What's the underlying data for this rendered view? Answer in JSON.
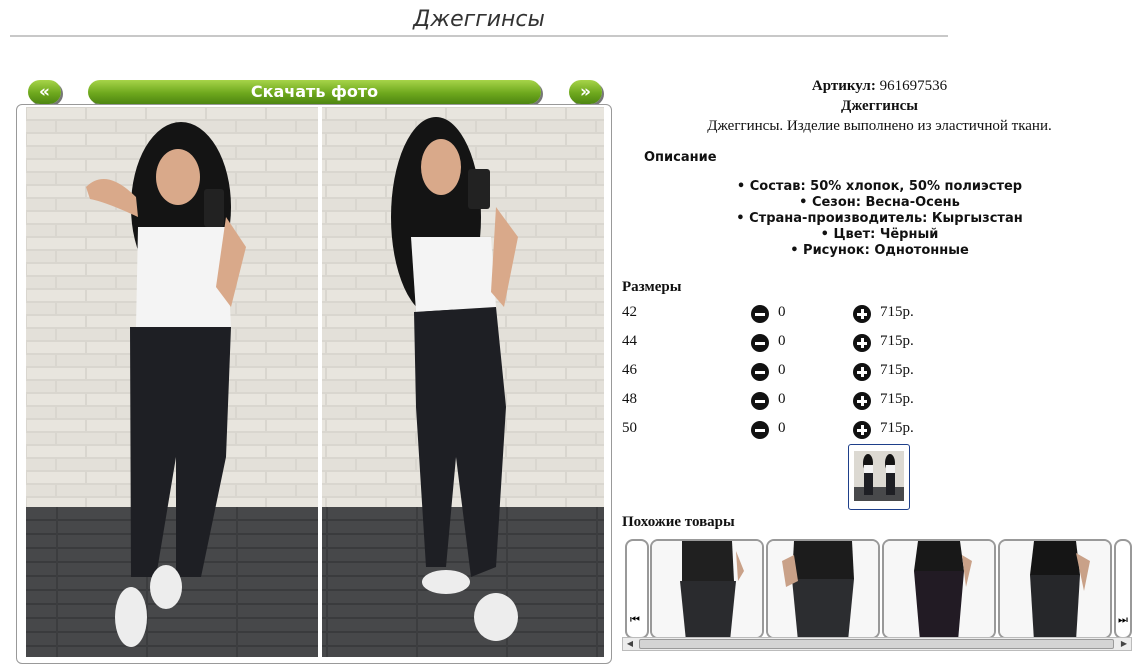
{
  "page": {
    "title": "Джеггинсы"
  },
  "gallery": {
    "prev_label": "«",
    "next_label": "»",
    "download_label": "Скачать фото"
  },
  "product": {
    "article_label": "Артикул:",
    "article_value": "961697536",
    "name": "Джеггинсы",
    "short_description": "Джеггинсы. Изделие выполнено из эластичной ткани.",
    "description_heading": "Описание",
    "properties": [
      "Состав: 50% хлопок, 50% полиэстер",
      "Сезон: Весна-Осень",
      "Страна-производитель: Кыргызстан",
      "Цвет: Чёрный",
      "Рисунок: Однотонные"
    ],
    "bullet": "•"
  },
  "sizes": {
    "heading": "Размеры",
    "rows": [
      {
        "size": "42",
        "qty": "0",
        "price": "715р."
      },
      {
        "size": "44",
        "qty": "0",
        "price": "715р."
      },
      {
        "size": "46",
        "qty": "0",
        "price": "715р."
      },
      {
        "size": "48",
        "qty": "0",
        "price": "715р."
      },
      {
        "size": "50",
        "qty": "0",
        "price": "715р."
      }
    ]
  },
  "similar": {
    "heading": "Похожие товары",
    "prev_icon": "skip-back-icon",
    "next_icon": "skip-forward-icon"
  },
  "colors": {
    "accent_green": "#6ea81d",
    "thumb_border": "#1e3f8a"
  }
}
